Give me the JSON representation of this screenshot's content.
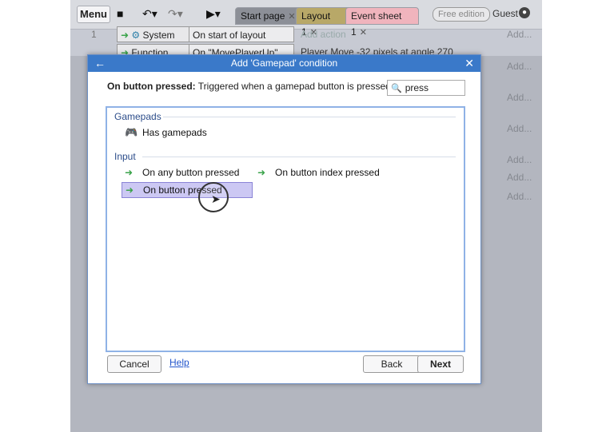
{
  "toolbar": {
    "menu_label": "Menu",
    "tabs": [
      {
        "label": "Start page"
      },
      {
        "label": "Layout 1"
      },
      {
        "label": "Event sheet 1"
      }
    ],
    "edition_badge": "Free edition",
    "user_label": "Guest"
  },
  "event_sheet": {
    "rows": [
      {
        "number": "1",
        "object": "System",
        "condition": "On start of layout",
        "action": "Add action"
      },
      {
        "number": "",
        "object": "Function",
        "condition": "On \"MovePlayerUp\"",
        "action": "Player  Move -32 pixels at angle 270"
      }
    ],
    "add_label": "Add..."
  },
  "dialog": {
    "title": "Add 'Gamepad' condition",
    "description_bold": "On button pressed:",
    "description_text": " Triggered when a gamepad button is pressed.",
    "search_value": "press",
    "categories": [
      {
        "name": "Gamepads",
        "items": [
          {
            "label": "Has gamepads",
            "icon": "gamepad-icon"
          }
        ]
      },
      {
        "name": "Input",
        "items": [
          {
            "label": "On any button pressed",
            "icon": "trigger-arrow-icon"
          },
          {
            "label": "On button index pressed",
            "icon": "trigger-arrow-icon"
          },
          {
            "label": "On button pressed",
            "icon": "trigger-arrow-icon",
            "selected": true
          }
        ]
      }
    ],
    "buttons": {
      "cancel": "Cancel",
      "help": "Help",
      "back": "Back",
      "next": "Next"
    }
  },
  "colors": {
    "title_bar": "#3a79c9",
    "selection": "#ccc8f3",
    "trigger_arrow": "#3aa34a",
    "category_text": "#2c4d8a"
  }
}
